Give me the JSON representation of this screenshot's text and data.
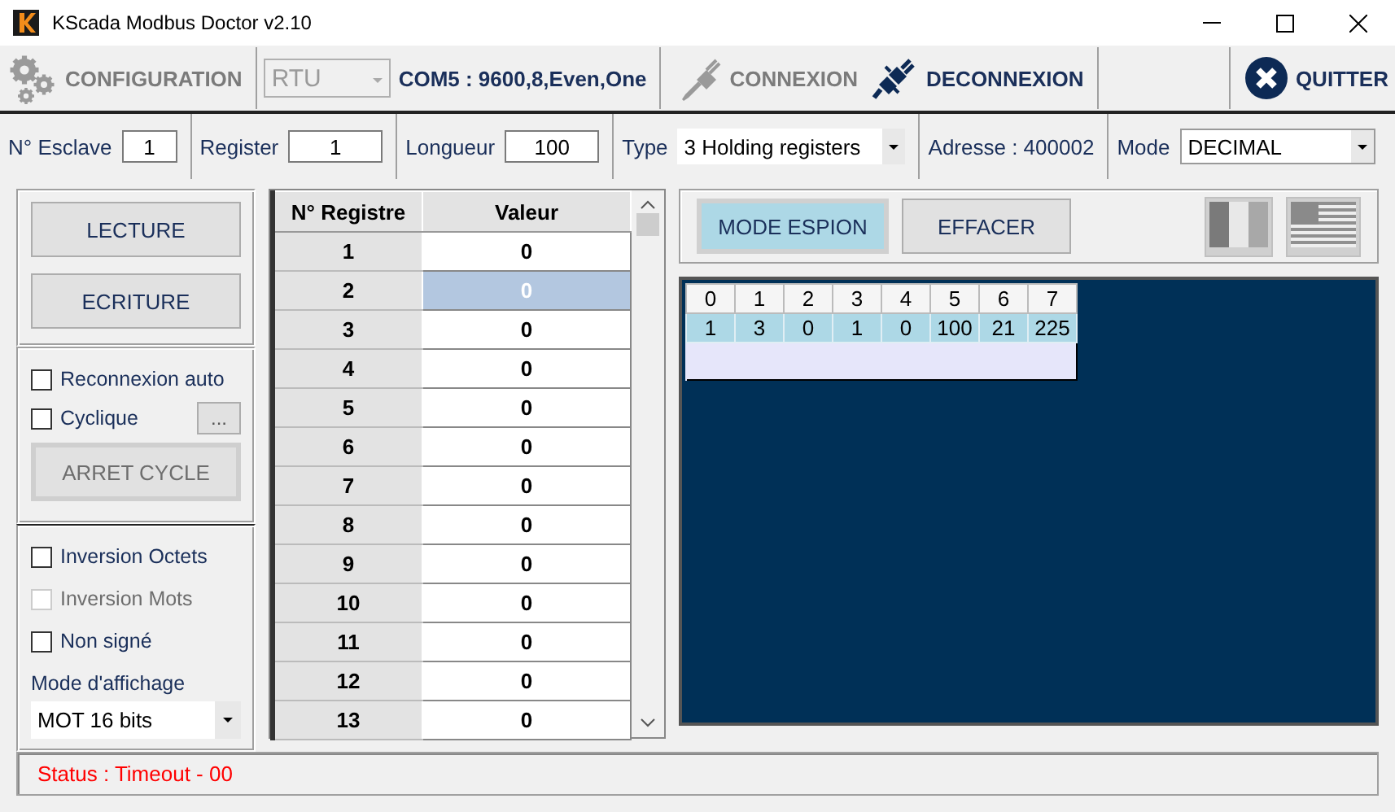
{
  "window": {
    "title": "KScada Modbus Doctor v2.10"
  },
  "toolbar": {
    "configuration": {
      "label": "CONFIGURATION",
      "disabled": true
    },
    "protocol": {
      "value": "RTU",
      "disabled": true
    },
    "port_settings": "COM5 : 9600,8,Even,One",
    "connexion": {
      "label": "CONNEXION",
      "disabled": true
    },
    "deconnexion": {
      "label": "DECONNEXION",
      "disabled": false
    },
    "quit": {
      "label": "QUITTER"
    }
  },
  "params": {
    "slave": {
      "label": "N° Esclave",
      "value": "1"
    },
    "register": {
      "label": "Register",
      "value": "1"
    },
    "length": {
      "label": "Longueur",
      "value": "100"
    },
    "type": {
      "label": "Type",
      "value": "3 Holding registers"
    },
    "address": "Adresse : 400002",
    "mode": {
      "label": "Mode",
      "value": "DECIMAL"
    }
  },
  "left_panel": {
    "buttons": [
      {
        "label": "LECTURE"
      },
      {
        "label": "ECRITURE"
      }
    ],
    "connection_options": [
      {
        "label": "Reconnexion auto",
        "checked": false
      },
      {
        "label": "Cyclique",
        "checked": false
      }
    ],
    "cycle_settings_button": "...",
    "stop_button": {
      "label": "ARRET CYCLE",
      "disabled": true
    },
    "format_options": [
      {
        "label": "Inversion Octets",
        "checked": false,
        "disabled": false
      },
      {
        "label": "Inversion Mots",
        "checked": false,
        "disabled": true
      },
      {
        "label": "Non signé",
        "checked": false,
        "disabled": false
      }
    ],
    "display_mode": {
      "label": "Mode d'affichage",
      "value": "MOT 16 bits"
    }
  },
  "register_table": {
    "columns": [
      "N° Registre",
      "Valeur"
    ],
    "rows": [
      {
        "register": "1",
        "value": "0",
        "selected": false
      },
      {
        "register": "2",
        "value": "0",
        "selected": true
      },
      {
        "register": "3",
        "value": "0",
        "selected": false
      },
      {
        "register": "4",
        "value": "0",
        "selected": false
      },
      {
        "register": "5",
        "value": "0",
        "selected": false
      },
      {
        "register": "6",
        "value": "0",
        "selected": false
      },
      {
        "register": "7",
        "value": "0",
        "selected": false
      },
      {
        "register": "8",
        "value": "0",
        "selected": false
      },
      {
        "register": "9",
        "value": "0",
        "selected": false
      },
      {
        "register": "10",
        "value": "0",
        "selected": false
      },
      {
        "register": "11",
        "value": "0",
        "selected": false
      },
      {
        "register": "12",
        "value": "0",
        "selected": false
      },
      {
        "register": "13",
        "value": "0",
        "selected": false
      }
    ]
  },
  "spy_panel": {
    "buttons": [
      {
        "label": "MODE ESPION",
        "on": true
      },
      {
        "label": "EFFACER",
        "on": false
      }
    ],
    "frame_table": {
      "columns": [
        "0",
        "1",
        "2",
        "3",
        "4",
        "5",
        "6",
        "7"
      ],
      "rows": [
        [
          "1",
          "3",
          "0",
          "1",
          "0",
          "100",
          "21",
          "225"
        ]
      ]
    }
  },
  "status_bar": {
    "text": "Status : Timeout - 00"
  }
}
